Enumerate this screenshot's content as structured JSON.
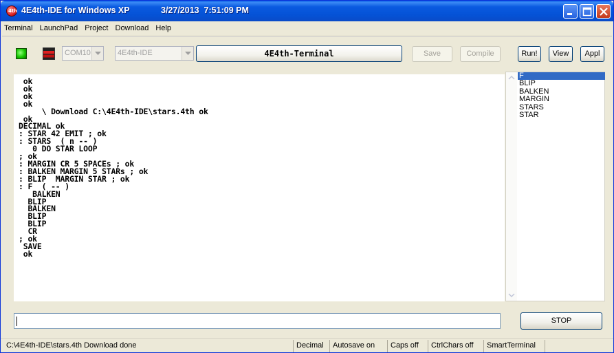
{
  "window": {
    "app_icon_text": "4th",
    "title": "4E4th-IDE for Windows XP",
    "datetime": "3/27/2013  7:51:09 PM"
  },
  "menu": [
    "Terminal",
    "LaunchPad",
    "Project",
    "Download",
    "Help"
  ],
  "toolbar": {
    "port": "COM10",
    "project": "4E4th-IDE",
    "terminal_label": "4E4th-Terminal",
    "save": "Save",
    "compile": "Compile",
    "run": "Run!",
    "view": "View",
    "appl": "Appl"
  },
  "terminal_lines": [
    " ok",
    " ok",
    " ok",
    " ok",
    "     \\ Download C:\\4E4th-IDE\\stars.4th ok",
    " ok",
    "DECIMAL ok",
    ": STAR 42 EMIT ; ok",
    ": STARS  ( n -- )",
    "   0 DO STAR LOOP",
    "; ok",
    ": MARGIN CR 5 SPACEs ; ok",
    ": BALKEN MARGIN 5 STARs ; ok",
    ": BLIP  MARGIN STAR ; ok",
    ": F  ( -- )",
    "   BALKEN",
    "  BLIP",
    "  BALKEN",
    "  BLIP",
    "  BLIP",
    "  CR",
    "; ok",
    " SAVE",
    " ok"
  ],
  "words": [
    "F",
    "BLIP",
    "BALKEN",
    "MARGIN",
    "STARS",
    "STAR"
  ],
  "selected_word_index": 0,
  "command_input": {
    "value": ""
  },
  "stop": "STOP",
  "status": {
    "message": "C:\\4E4th-IDE\\stars.4th Download done",
    "base": "Decimal",
    "autosave": "Autosave on",
    "caps": "Caps off",
    "ctrlchars": "CtrlChars off",
    "mode": "SmartTerminal"
  },
  "colors": {
    "titlebar": "#0a5ae0",
    "window_bg": "#ece9d8",
    "selection": "#316ac5",
    "led_on": "#17c700",
    "led_off": "#e02020"
  }
}
